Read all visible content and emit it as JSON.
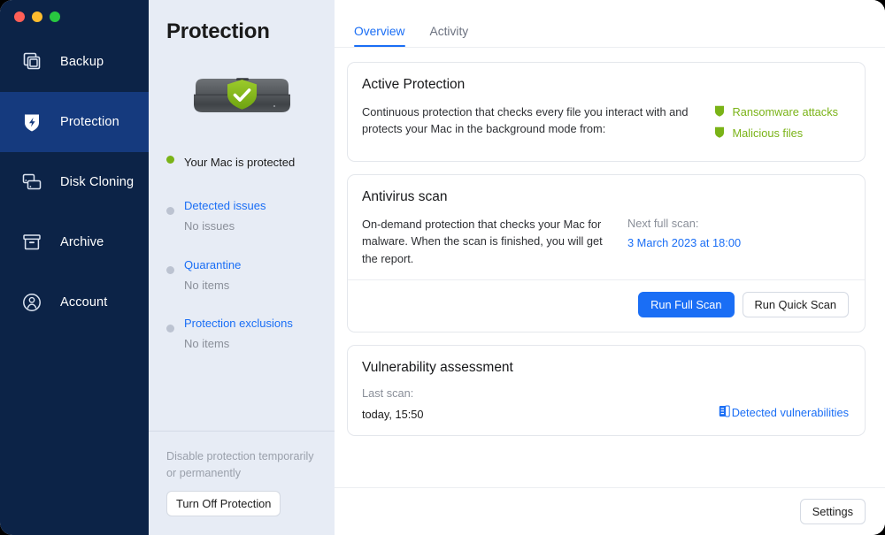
{
  "window": {
    "traffic_lights": [
      {
        "name": "close",
        "color": "#ff5f57"
      },
      {
        "name": "minimize",
        "color": "#febc2e"
      },
      {
        "name": "zoom",
        "color": "#28c840"
      }
    ]
  },
  "sidebar": {
    "items": [
      {
        "label": "Backup",
        "icon": "copy-stack-icon",
        "active": false
      },
      {
        "label": "Protection",
        "icon": "shield-bolt-icon",
        "active": true
      },
      {
        "label": "Disk Cloning",
        "icon": "disk-cloning-icon",
        "active": false
      },
      {
        "label": "Archive",
        "icon": "archive-box-icon",
        "active": false
      },
      {
        "label": "Account",
        "icon": "user-circle-icon",
        "active": false
      }
    ]
  },
  "middle": {
    "title": "Protection",
    "hero_icon": "external-drive-shield-icon",
    "status": [
      {
        "label": "Your Mac is protected",
        "sub": "",
        "dot": "green",
        "link": false
      },
      {
        "label": "Detected issues",
        "sub": "No issues",
        "dot": "gray",
        "link": true
      },
      {
        "label": "Quarantine",
        "sub": "No items",
        "dot": "gray",
        "link": true
      },
      {
        "label": "Protection exclusions",
        "sub": "No items",
        "dot": "gray",
        "link": true
      }
    ],
    "disable_text": "Disable protection temporarily or permanently",
    "turn_off_label": "Turn Off Protection"
  },
  "main": {
    "tabs": [
      {
        "label": "Overview",
        "active": true
      },
      {
        "label": "Activity",
        "active": false
      }
    ],
    "active_protection": {
      "title": "Active Protection",
      "description": "Continuous protection that checks every file you interact with and protects your Mac in the background mode from:",
      "threats": [
        {
          "label": "Ransomware attacks",
          "icon": "shield-icon"
        },
        {
          "label": "Malicious files",
          "icon": "shield-icon"
        }
      ]
    },
    "antivirus": {
      "title": "Antivirus scan",
      "description": "On-demand protection that checks your Mac for malware. When the scan is finished, you will get the report.",
      "next_scan_label": "Next full scan:",
      "next_scan_value": "3 March 2023 at 18:00",
      "run_full_label": "Run Full Scan",
      "run_quick_label": "Run Quick Scan"
    },
    "vulnerability": {
      "title": "Vulnerability assessment",
      "last_scan_label": "Last scan:",
      "last_scan_value": "today, 15:50",
      "link_label": "Detected vulnerabilities",
      "link_icon": "report-document-icon"
    },
    "footer": {
      "settings_label": "Settings"
    }
  },
  "colors": {
    "sidebar_bg": "#0c2347",
    "sidebar_active": "#153a7e",
    "accent_blue": "#1a6ef5",
    "green": "#7ab317",
    "mid_bg": "#e7ecf5"
  }
}
